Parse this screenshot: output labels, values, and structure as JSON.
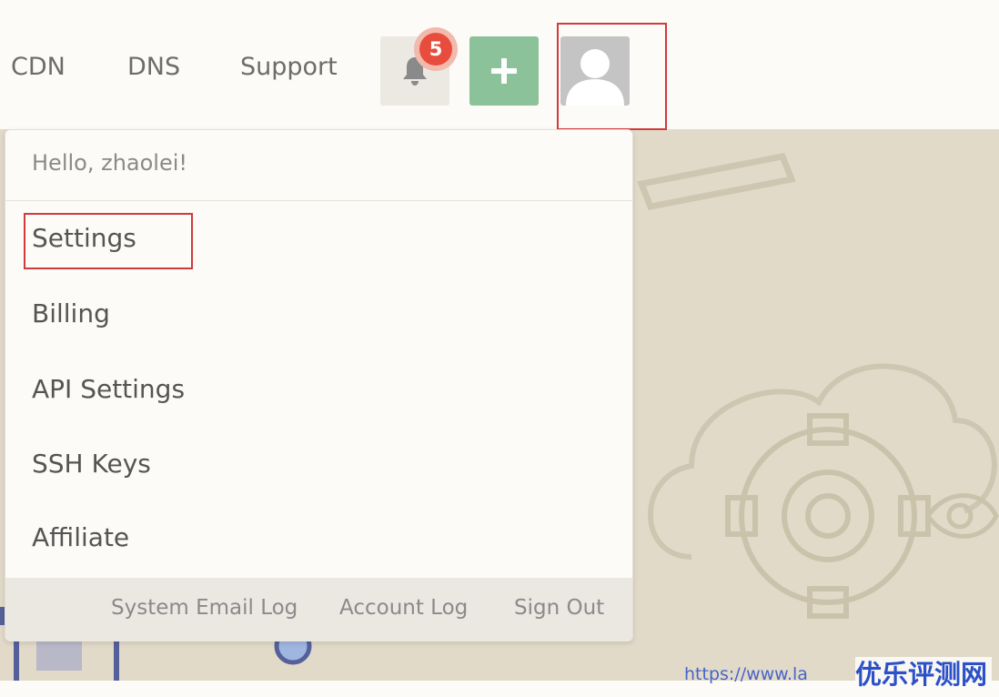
{
  "nav": {
    "links": [
      "CDN",
      "DNS",
      "Support"
    ],
    "notification_count": "5",
    "add_icon": "plus-icon",
    "bell_icon": "bell-icon",
    "avatar_icon": "user-avatar-icon"
  },
  "dropdown": {
    "greeting": "Hello, zhaolei!",
    "items": [
      "Settings",
      "Billing",
      "API Settings",
      "SSH Keys",
      "Affiliate"
    ],
    "footer_links": [
      "System Email Log",
      "Account Log",
      "Sign Out"
    ]
  },
  "watermark": {
    "url": "https://www.la",
    "brand": "优乐评测网"
  },
  "colors": {
    "accent_green": "#8cc29a",
    "badge_red": "#e74c3c",
    "highlight_red": "#d03a3a",
    "watermark_blue": "#2b50c8"
  }
}
